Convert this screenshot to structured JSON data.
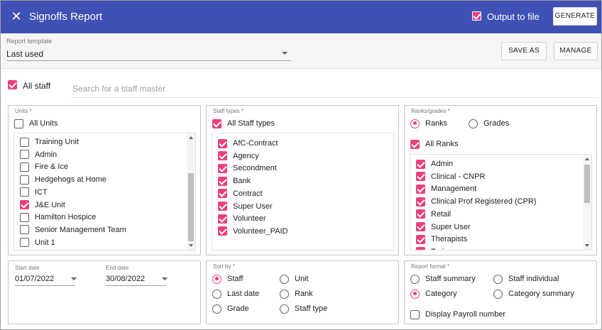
{
  "header": {
    "title": "Signoffs Report",
    "output_label": "Output to file",
    "output_checked": true,
    "generate_label": "GENERATE"
  },
  "template": {
    "label": "Report template",
    "value": "Last used",
    "save_as_label": "SAVE AS",
    "manage_label": "MANAGE"
  },
  "staff": {
    "all_staff_label": "All staff",
    "all_staff_checked": true,
    "search_placeholder": "Search for a staff master"
  },
  "units": {
    "label": "Units *",
    "all_label": "All Units",
    "all_checked": false,
    "items": [
      {
        "label": "Training Unit",
        "checked": false
      },
      {
        "label": "Admin",
        "checked": false
      },
      {
        "label": "Fire & Ice",
        "checked": false
      },
      {
        "label": "Hedgehogs at Home",
        "checked": false
      },
      {
        "label": "ICT",
        "checked": false
      },
      {
        "label": "J&E Unit",
        "checked": true
      },
      {
        "label": "Hamilton Hospice",
        "checked": false
      },
      {
        "label": "Senior Management Team",
        "checked": false
      },
      {
        "label": "Unit 1",
        "checked": false
      }
    ]
  },
  "staff_types": {
    "label": "Staff types *",
    "all_label": "All Staff types",
    "all_checked": true,
    "items": [
      {
        "label": "AfC-Contract",
        "checked": true
      },
      {
        "label": "Agency",
        "checked": true
      },
      {
        "label": "Secondment",
        "checked": true
      },
      {
        "label": "Bank",
        "checked": true
      },
      {
        "label": "Contract",
        "checked": true
      },
      {
        "label": "Super User",
        "checked": true
      },
      {
        "label": "Volunteer",
        "checked": true
      },
      {
        "label": "Volunteer_PAID",
        "checked": true
      }
    ]
  },
  "ranks": {
    "label": "Ranks/grades *",
    "ranks_label": "Ranks",
    "grades_label": "Grades",
    "selected": "Ranks",
    "all_label": "All Ranks",
    "all_checked": true,
    "items": [
      {
        "label": "Admin",
        "checked": true
      },
      {
        "label": "Clinical - CNPR",
        "checked": true
      },
      {
        "label": "Management",
        "checked": true
      },
      {
        "label": "Clinical Prof Registered (CPR)",
        "checked": true
      },
      {
        "label": "Retail",
        "checked": true
      },
      {
        "label": "Super User",
        "checked": true
      },
      {
        "label": "Therapists",
        "checked": true
      },
      {
        "label": "Trainees",
        "checked": true
      }
    ]
  },
  "dates": {
    "start_label": "Start date",
    "start_value": "01/07/2022",
    "end_label": "End date",
    "end_value": "30/08/2022"
  },
  "sort": {
    "label": "Sort by *",
    "selected": "Staff",
    "options": [
      "Staff",
      "Unit",
      "Last date",
      "Rank",
      "Grade",
      "Staff type"
    ]
  },
  "format": {
    "label": "Report format *",
    "selected": "Category",
    "options": [
      "Staff summary",
      "Staff individual",
      "Category",
      "Category summary"
    ],
    "payroll_label": "Display Payroll number",
    "payroll_checked": false
  },
  "colors": {
    "header": "#3f51b5",
    "accent": "#ec407a"
  }
}
